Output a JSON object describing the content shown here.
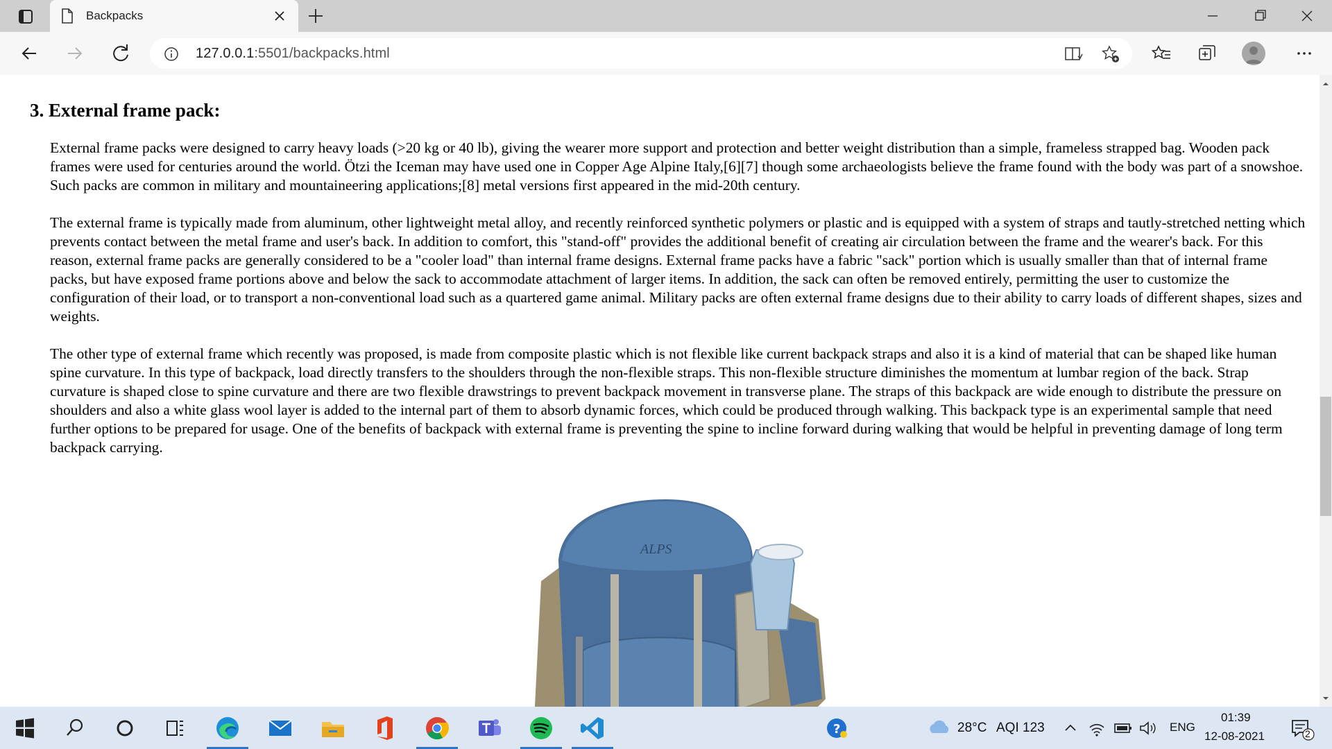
{
  "browser": {
    "tab_title": "Backpacks",
    "url_host": "127.0.0.1",
    "url_path": ":5501/backpacks.html"
  },
  "page": {
    "heading_number": "3.",
    "heading": "External frame pack:",
    "paragraphs": [
      "External frame packs were designed to carry heavy loads (>20 kg or 40 lb), giving the wearer more support and protection and better weight distribution than a simple, frameless strapped bag. Wooden pack frames were used for centuries around the world. Ötzi the Iceman may have used one in Copper Age Alpine Italy,[6][7] though some archaeologists believe the frame found with the body was part of a snowshoe. Such packs are common in military and mountaineering applications;[8] metal versions first appeared in the mid-20th century.",
      "The external frame is typically made from aluminum, other lightweight metal alloy, and recently reinforced synthetic polymers or plastic and is equipped with a system of straps and tautly-stretched netting which prevents contact between the metal frame and user's back. In addition to comfort, this \"stand-off\" provides the additional benefit of creating air circulation between the frame and the wearer's back. For this reason, external frame packs are generally considered to be a \"cooler load\" than internal frame designs. External frame packs have a fabric \"sack\" portion which is usually smaller than that of internal frame packs, but have exposed frame portions above and below the sack to accommodate attachment of larger items. In addition, the sack can often be removed entirely, permitting the user to customize the configuration of their load, or to transport a non-conventional load such as a quartered game animal. Military packs are often external frame designs due to their ability to carry loads of different shapes, sizes and weights.",
      "The other type of external frame which recently was proposed, is made from composite plastic which is not flexible like current backpack straps and also it is a kind of material that can be shaped like human spine curvature. In this type of backpack, load directly transfers to the shoulders through the non-flexible straps. This non-flexible structure diminishes the momentum at lumbar region of the back. Strap curvature is shaped close to spine curvature and there are two flexible drawstrings to prevent backpack movement in transverse plane. The straps of this backpack are wide enough to distribute the pressure on shoulders and also a white glass wool layer is added to the internal part of them to absorb dynamic forces, which could be produced through walking. This backpack type is an experimental sample that need further options to be prepared for usage. One of the benefits of backpack with external frame is preventing the spine to incline forward during walking that would be helpful in preventing damage of long term backpack carrying."
    ],
    "image_brand": "ALPS"
  },
  "taskbar": {
    "weather": "28°C",
    "aqi": "AQI 123",
    "language": "ENG",
    "time": "01:39",
    "date": "12-08-2021",
    "notification_count": "2",
    "apps": [
      "start-icon",
      "search-icon",
      "cortana-icon",
      "task-view-icon",
      "edge-icon",
      "mail-icon",
      "file-explorer-icon",
      "office-icon",
      "chrome-icon",
      "teams-icon",
      "spotify-icon",
      "vscode-icon"
    ]
  },
  "colors": {
    "tabbar": "#cfcfcf",
    "navbar": "#f7f7f7",
    "taskbar": "#dde6f3",
    "accent": "#2b74c8",
    "backpack_blue": "#4a6f9a",
    "backpack_tan": "#9d9070"
  }
}
